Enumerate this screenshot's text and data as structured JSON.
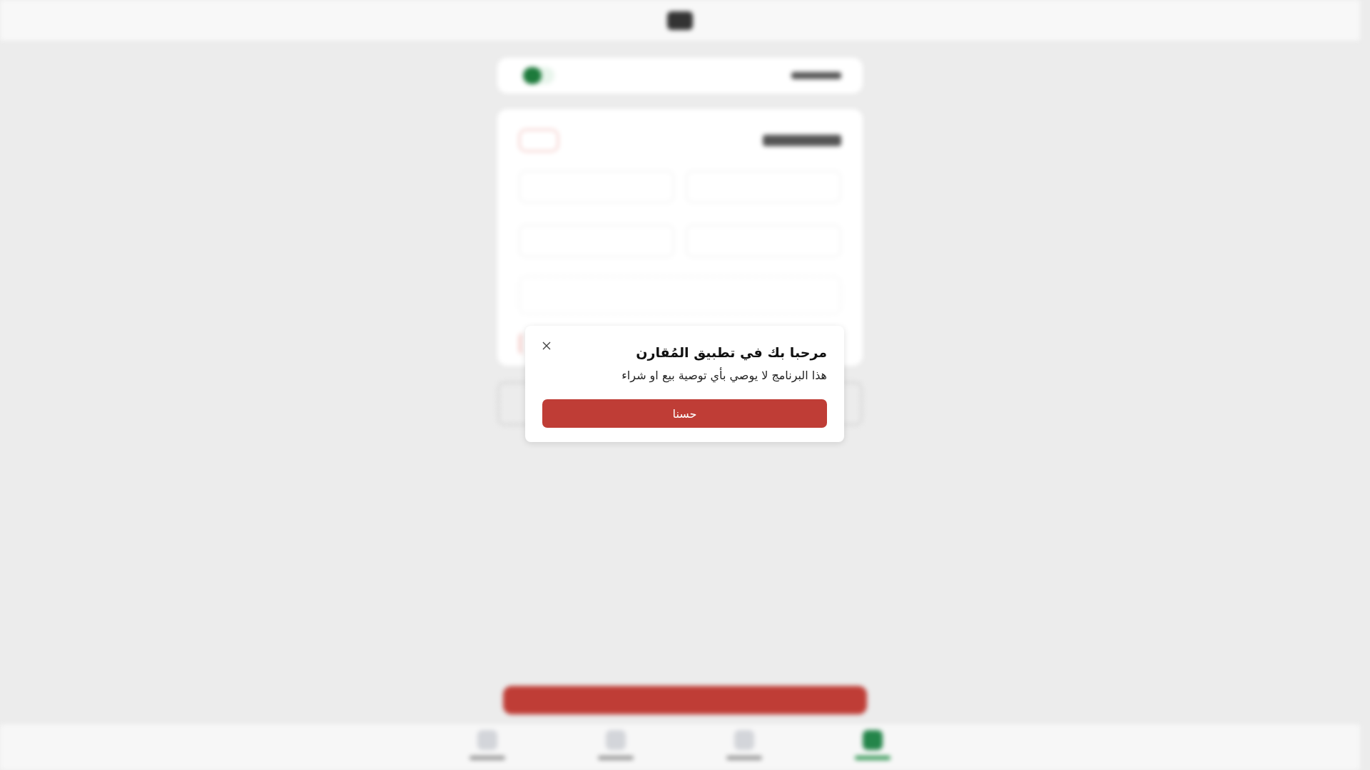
{
  "dialog": {
    "title": "مرحبا بك في تطبيق المُقارن",
    "message": "هذا البرنامج لا يوصي بأي توصية بيع او شراء",
    "button": "حسنا"
  }
}
